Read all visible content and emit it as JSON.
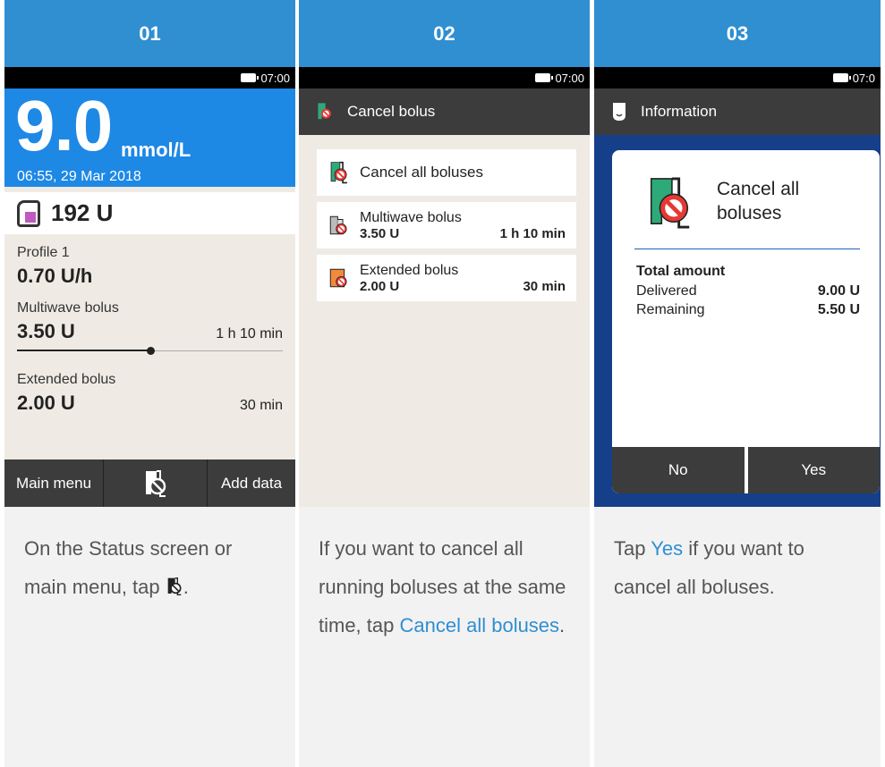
{
  "steps": [
    {
      "number": "01"
    },
    {
      "number": "02"
    },
    {
      "number": "03"
    }
  ],
  "screen1": {
    "time": "07:00",
    "bg_value": "9.0",
    "bg_unit": "mmol/L",
    "bg_timestamp": "06:55, 29 Mar 2018",
    "insulin": "192 U",
    "profile_label": "Profile 1",
    "basal_rate": "0.70 U/h",
    "multiwave_label": "Multiwave bolus",
    "multiwave_amount": "3.50 U",
    "multiwave_duration": "1 h 10 min",
    "multiwave_progress": 0.5,
    "extended_label": "Extended bolus",
    "extended_amount": "2.00 U",
    "extended_duration": "30 min",
    "main_menu": "Main menu",
    "add_data": "Add data"
  },
  "screen2": {
    "time": "07:00",
    "title": "Cancel bolus",
    "cancel_all": "Cancel all boluses",
    "items": [
      {
        "label": "Multiwave bolus",
        "amount": "3.50 U",
        "duration": "1 h 10 min"
      },
      {
        "label": "Extended bolus",
        "amount": "2.00 U",
        "duration": "30 min"
      }
    ]
  },
  "screen3": {
    "time": "07:0",
    "title": "Information",
    "dialog_title": "Cancel all boluses",
    "total_label": "Total amount",
    "delivered_label": "Delivered",
    "delivered_value": "9.00 U",
    "remaining_label": "Remaining",
    "remaining_value": "5.50 U",
    "no": "No",
    "yes": "Yes"
  },
  "descriptions": {
    "d1_text": "On the Status screen or main menu, tap",
    "d2_before": "If you want to cancel all running boluses at the same time, tap",
    "d2_link": "Cancel all boluses",
    "d3_before": "Tap",
    "d3_link": "Yes",
    "d3_after": "if you want to cancel all boluses."
  },
  "colors": {
    "header": "#2f8fd0",
    "bg_blue": "#1e88e5",
    "dialog_bg": "#163f8a"
  }
}
